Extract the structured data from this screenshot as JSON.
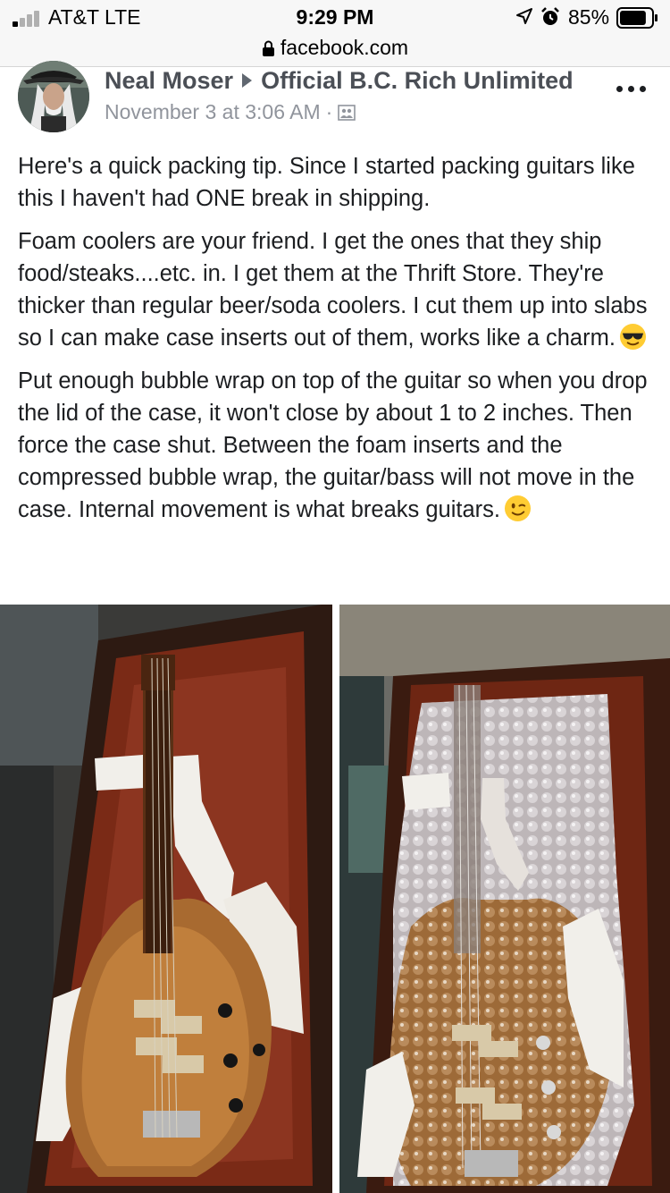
{
  "status_bar": {
    "carrier": "AT&T  LTE",
    "time": "9:29 PM",
    "battery": "85%",
    "battery_level": 0.85,
    "icons": [
      "signal-icon",
      "location-arrow-icon",
      "alarm-icon",
      "battery-icon"
    ]
  },
  "browser": {
    "url": "facebook.com",
    "icons": [
      "lock-icon"
    ]
  },
  "post": {
    "author": "Neal Moser",
    "group": "Official B.C. Rich Unlimited",
    "timestamp": "November 3 at 3:06 AM",
    "separator": "·",
    "icons": [
      "avatar",
      "share-arrow-icon",
      "more-options-icon",
      "members-audience-icon"
    ],
    "paragraphs": [
      "Here's a quick packing tip. Since I started packing guitars like this I haven't had ONE break in shipping.",
      "Foam coolers are your friend. I get the ones that they ship food/steaks....etc. in. I get them at the Thrift Store. They're thicker than regular beer/soda coolers. I cut them up into slabs so I can make case inserts out of them, works like a charm.",
      "Put enough bubble wrap on top of the guitar so when you drop the lid of the case, it won't close by about 1 to 2 inches. Then force the case shut. Between the foam inserts and the compressed bubble wrap, the guitar/bass will not move in the case. Internal movement is what breaks guitars."
    ],
    "emojis": [
      "sunglasses-emoji",
      "winking-face-emoji"
    ],
    "photos": [
      "bass-in-case-with-foam-photo",
      "bass-wrapped-in-bubble-wrap-photo"
    ]
  },
  "colors": {
    "name": "#4b4f56",
    "meta": "#90949c",
    "text": "#1c1e21",
    "case_lining": "#7a2a16",
    "guitar_wood": "#a86a30",
    "foam": "#f1efea"
  }
}
